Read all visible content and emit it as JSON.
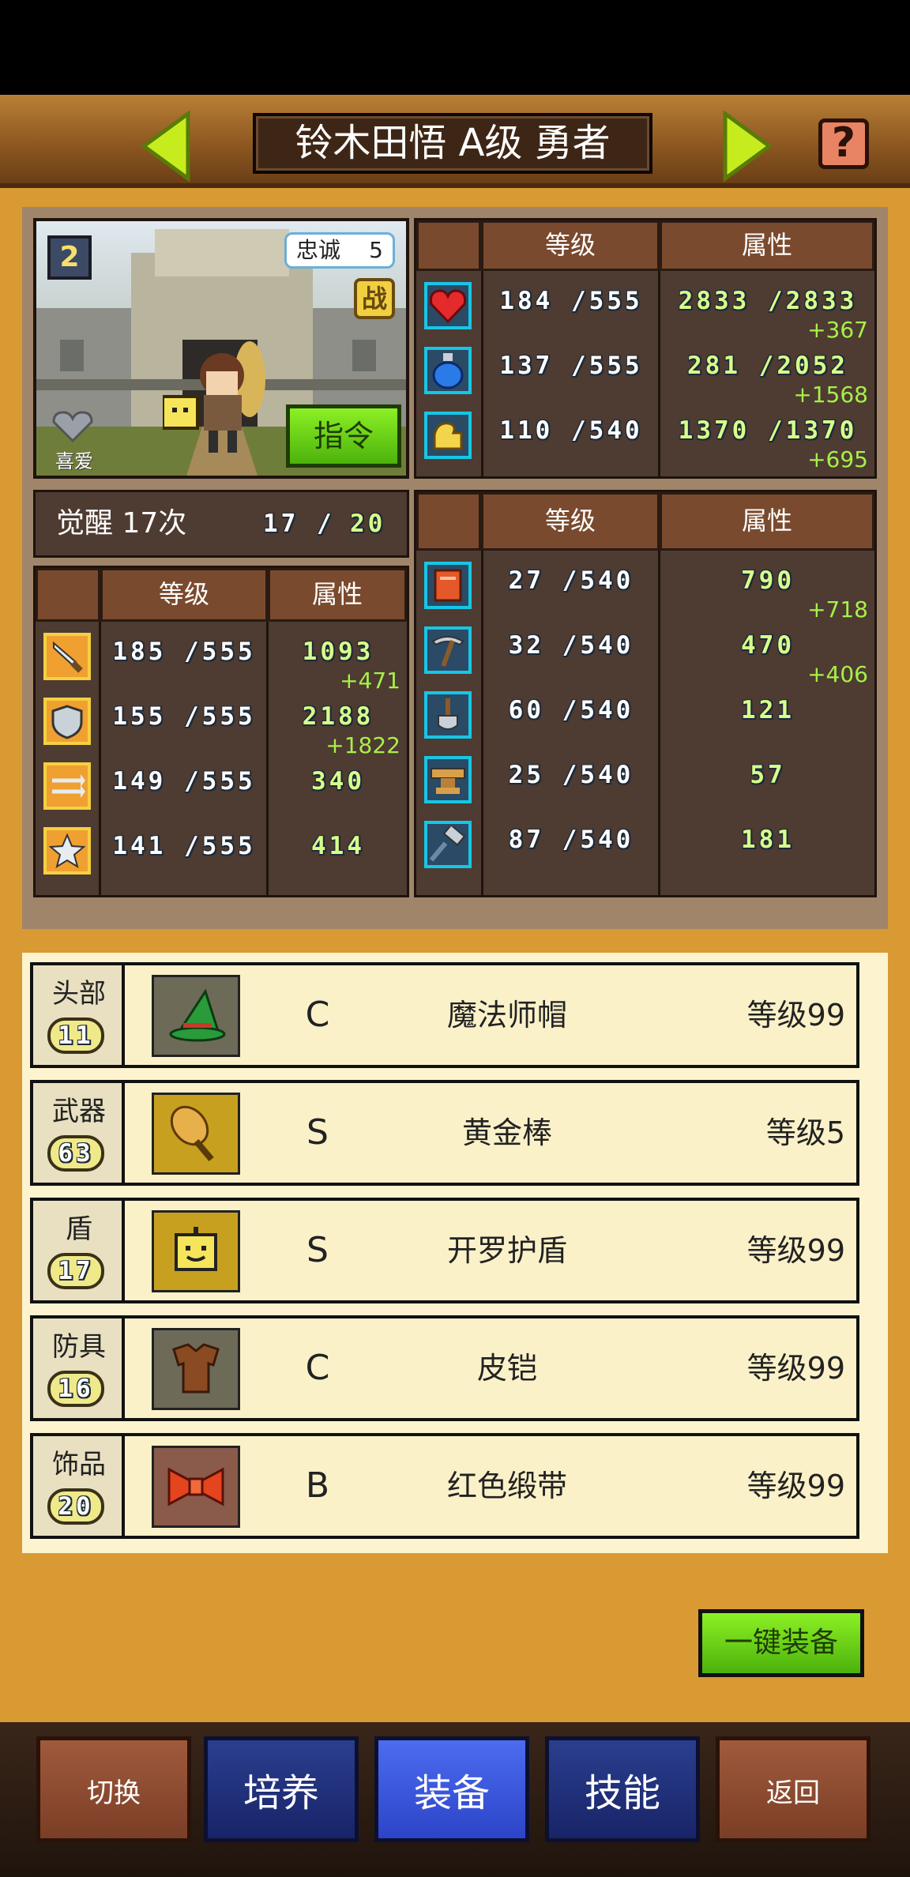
{
  "header": {
    "title": "铃木田悟 A级 勇者",
    "help_label": "?"
  },
  "portrait": {
    "rank_badge": "2",
    "loyalty_label": "忠诚",
    "loyalty_value": "5",
    "battle_label": "战",
    "favorite_label": "喜爱",
    "command_label": "指令"
  },
  "columns": {
    "level": "等级",
    "attribute": "属性"
  },
  "vitals": [
    {
      "icon": "heart-icon",
      "level": "184 /555",
      "attr": "2833 /2833",
      "bonus": "+367"
    },
    {
      "icon": "mana-potion-icon",
      "level": "137 /555",
      "attr": "281 /2052",
      "bonus": "+1568"
    },
    {
      "icon": "stamina-arm-icon",
      "level": "110 /540",
      "attr": "1370 /1370",
      "bonus": "+695"
    }
  ],
  "awaken": {
    "label": "觉醒 17次",
    "progress": "17 /",
    "max": "20"
  },
  "combat_stats": [
    {
      "icon": "sword-icon",
      "level": "185 /555",
      "attr": "1093",
      "bonus": "+471"
    },
    {
      "icon": "shield-icon",
      "level": "155 /555",
      "attr": "2188",
      "bonus": "+1822"
    },
    {
      "icon": "arrows-icon",
      "level": "149 /555",
      "attr": "340",
      "bonus": ""
    },
    {
      "icon": "star-icon",
      "level": "141 /555",
      "attr": "414",
      "bonus": ""
    }
  ],
  "work_stats": [
    {
      "icon": "book-icon",
      "level": "27 /540",
      "attr": "790",
      "bonus": "+718"
    },
    {
      "icon": "pickaxe-icon",
      "level": "32 /540",
      "attr": "470",
      "bonus": "+406"
    },
    {
      "icon": "shovel-icon",
      "level": "60 /540",
      "attr": "121",
      "bonus": ""
    },
    {
      "icon": "anvil-icon",
      "level": "25 /540",
      "attr": "57",
      "bonus": ""
    },
    {
      "icon": "hammer-icon",
      "level": "87 /540",
      "attr": "181",
      "bonus": ""
    }
  ],
  "equipment": [
    {
      "slot": "头部",
      "slot_level": "11",
      "icon": "wizard-hat-icon",
      "grade": "C",
      "name": "魔法师帽",
      "level": "等级99",
      "icon_bg": "#6e6a58"
    },
    {
      "slot": "武器",
      "slot_level": "63",
      "icon": "golden-club-icon",
      "grade": "S",
      "name": "黄金棒",
      "level": "等级5",
      "icon_bg": "#c8a020"
    },
    {
      "slot": "盾",
      "slot_level": "17",
      "icon": "cairo-shield-icon",
      "grade": "S",
      "name": "开罗护盾",
      "level": "等级99",
      "icon_bg": "#c8a020"
    },
    {
      "slot": "防具",
      "slot_level": "16",
      "icon": "leather-armor-icon",
      "grade": "C",
      "name": "皮铠",
      "level": "等级99",
      "icon_bg": "#6e6a58"
    },
    {
      "slot": "饰品",
      "slot_level": "20",
      "icon": "red-ribbon-icon",
      "grade": "B",
      "name": "红色缎带",
      "level": "等级99",
      "icon_bg": "#8a5a4a"
    }
  ],
  "onekey_label": "一键装备",
  "nav": {
    "switch": "切换",
    "train": "培养",
    "equip": "装备",
    "skill": "技能",
    "back": "返回"
  },
  "colors": {
    "accent_green": "#8cf024",
    "panel_dark": "#4e3b31",
    "bonus_green": "#a6f04a",
    "bg_orange": "#d99a34"
  }
}
